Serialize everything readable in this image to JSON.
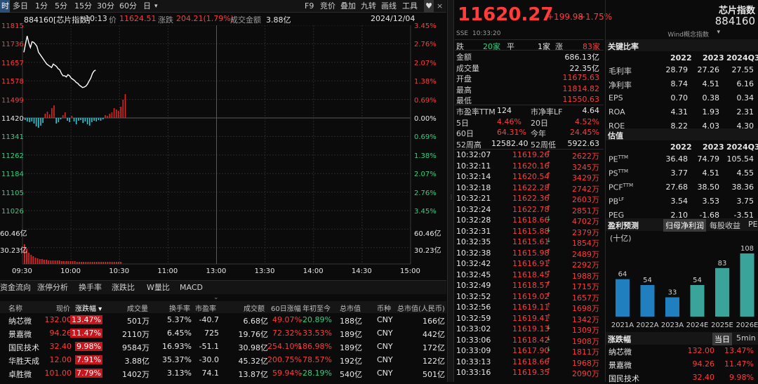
{
  "toolbar": {
    "left": [
      "时",
      "多日",
      "1分",
      "5分",
      "15分",
      "30分",
      "60分",
      "日",
      "▾"
    ],
    "right": [
      "F9",
      "竞价",
      "叠加",
      "九转",
      "画线",
      "工具"
    ],
    "heart": "♥"
  },
  "info": {
    "code": "884160[芯片指数]",
    "time": "10:13",
    "price_label": "价",
    "price": "11624.51",
    "chg_label": "涨跌",
    "chg": "204.21(1.79%)",
    "amt_label": "成交金额",
    "amt": "3.88亿",
    "date": "2024/12/04"
  },
  "chart_data": {
    "type": "line",
    "title": "",
    "x_ticks": [
      "09:30",
      "10:00",
      "10:30",
      "11:00",
      "13:00",
      "13:30",
      "14:00",
      "14:30",
      "15:00"
    ],
    "y_ticks": [
      "11815",
      "11736",
      "11657",
      "11578",
      "11499",
      "11420",
      "11341",
      "11262",
      "11184",
      "11105",
      "11026"
    ],
    "pct_ticks": [
      "3.45%",
      "2.76%",
      "2.07%",
      "1.38%",
      "0.69%",
      "0.00%",
      "0.69%",
      "1.38%",
      "2.07%",
      "2.76%",
      "3.45%"
    ],
    "vol_ticks": [
      "60.46亿",
      "30.23亿"
    ],
    "prev_close": 11420.3,
    "price_series": [
      11700,
      11735,
      11770,
      11740,
      11720,
      11745,
      11742,
      11735,
      11725,
      11700,
      11690,
      11680,
      11670,
      11660,
      11650,
      11645,
      11640,
      11635,
      11650,
      11645,
      11640,
      11630,
      11625,
      11610,
      11600,
      11600,
      11595,
      11605,
      11600,
      11590,
      11585,
      11580,
      11572,
      11568,
      11560,
      11555,
      11550,
      11552,
      11556,
      11565,
      11578,
      11590,
      11610,
      11620,
      11624
    ],
    "flow_bars": [
      -3,
      -5,
      -6,
      -5,
      -8,
      -12,
      -14,
      -11,
      -7,
      6,
      9,
      5,
      14,
      18,
      -8,
      -6,
      -2,
      4,
      8,
      -4,
      -6,
      3,
      -5,
      -9,
      -4,
      -3,
      -7,
      -5,
      -9,
      -11,
      -6,
      -4,
      -5,
      -3,
      -4,
      -2,
      4,
      3,
      6,
      8,
      14,
      12,
      10,
      16,
      26,
      34
    ],
    "volume_bars": [
      28,
      22,
      16,
      13,
      11,
      9,
      8,
      7,
      7,
      6,
      6,
      5,
      5,
      5,
      5,
      5,
      5,
      4,
      4,
      4,
      4,
      4,
      4,
      4,
      3,
      3,
      3,
      3,
      3,
      3,
      3,
      3,
      3,
      3,
      3,
      3,
      3,
      3,
      3,
      3,
      3,
      3,
      3,
      3,
      3
    ]
  },
  "bottom_tabs": [
    "资金流向",
    "涨停分析",
    "换手率",
    "涨跌比",
    "W量比",
    "MACD"
  ],
  "table": {
    "headers": [
      "名称",
      "现价",
      "涨跌幅 ▾",
      "成交量",
      "换手率",
      "市盈率",
      "成交额",
      "60日涨幅",
      "年初至今",
      "总市值",
      "币种",
      "总市值(人民币)"
    ],
    "rows": [
      [
        "纳芯微",
        "132.00",
        "13.47%",
        "501万",
        "5.37%",
        "-40.7",
        "6.68亿",
        "49.07%",
        "-20.89%",
        "188亿",
        "CNY",
        "166亿"
      ],
      [
        "景嘉微",
        "94.26",
        "11.47%",
        "2110万",
        "6.45%",
        "725",
        "19.76亿",
        "72.32%",
        "33.53%",
        "189亿",
        "CNY",
        "442亿"
      ],
      [
        "国民技术",
        "32.40",
        "9.98%",
        "9584万",
        "16.93%",
        "-51.1",
        "30.98亿",
        "254.10%",
        "186.98%",
        "189亿",
        "CNY",
        "172亿"
      ],
      [
        "华胜天成",
        "12.00",
        "7.91%",
        "3.88亿",
        "35.37%",
        "-30.0",
        "45.32亿",
        "200.75%",
        "78.57%",
        "192亿",
        "CNY",
        "122亿"
      ],
      [
        "卓胜微",
        "101.00",
        "7.79%",
        "1402万",
        "3.13%",
        "74.1",
        "13.87亿",
        "59.94%",
        "-28.19%",
        "540亿",
        "CNY",
        "501亿"
      ]
    ]
  },
  "quote": {
    "price": "11620.27",
    "chg": "+199.98",
    "pct": "+1.75%",
    "exchange": "SSE",
    "time": "10:33:20",
    "breadth": {
      "down_label": "跌",
      "down": "20家",
      "flat_label": "平",
      "flat": "1家",
      "up_label": "涨",
      "up": "83家"
    },
    "stats": [
      [
        "金额",
        "686.13亿"
      ],
      [
        "成交量",
        "22.35亿"
      ],
      [
        "开盘",
        "11675.63"
      ],
      [
        "最高",
        "11814.82"
      ],
      [
        "最低",
        "11550.63"
      ]
    ],
    "metrics": [
      [
        "市盈率TTM",
        "124",
        "市净率LF",
        "4.64"
      ],
      [
        "5日",
        "4.46%",
        "20日",
        "4.52%"
      ],
      [
        "60日",
        "64.31%",
        "今年",
        "24.45%"
      ],
      [
        "52周高",
        "12582.40",
        "52周低",
        "5922.63"
      ]
    ],
    "ticks": [
      [
        "10:32:07",
        "11619.26",
        "2622万"
      ],
      [
        "10:32:11",
        "11620.16",
        "3245万"
      ],
      [
        "10:32:14",
        "11620.54",
        "3429万"
      ],
      [
        "10:32:18",
        "11622.28",
        "2742万"
      ],
      [
        "10:32:21",
        "11622.36",
        "2603万"
      ],
      [
        "10:32:24",
        "11622.78",
        "2851万"
      ],
      [
        "10:32:28",
        "11618.66",
        "4702万"
      ],
      [
        "10:32:31",
        "11615.88",
        "2379万"
      ],
      [
        "10:32:35",
        "11615.61",
        "1854万"
      ],
      [
        "10:32:38",
        "11615.98",
        "2489万"
      ],
      [
        "10:32:42",
        "11616.91",
        "2292万"
      ],
      [
        "10:32:45",
        "11618.45",
        "1988万"
      ],
      [
        "10:32:49",
        "11618.57",
        "1715万"
      ],
      [
        "10:32:52",
        "11619.02",
        "1657万"
      ],
      [
        "10:32:56",
        "11619.11",
        "1698万"
      ],
      [
        "10:32:59",
        "11619.41",
        "1342万"
      ],
      [
        "10:33:02",
        "11619.13",
        "1309万"
      ],
      [
        "10:33:06",
        "11618.42",
        "1908万"
      ],
      [
        "10:33:09",
        "11617.90",
        "1811万"
      ],
      [
        "10:33:13",
        "11618.66",
        "1968万"
      ],
      [
        "10:33:16",
        "11619.35",
        "2090万"
      ]
    ],
    "tick_dirs": [
      "up",
      "up",
      "up",
      "up",
      "up",
      "up",
      "down",
      "down",
      "down",
      "up",
      "up",
      "up",
      "up",
      "up",
      "up",
      "up",
      "down",
      "down",
      "down",
      "up",
      "up"
    ]
  },
  "fin": {
    "name": "芯片指数",
    "code": "884160",
    "tag": "Wind概念指数",
    "ratio_title": "关键比率",
    "years": [
      "2022",
      "2023",
      "2024Q3"
    ],
    "ratios": [
      [
        "毛利率",
        "28.79",
        "27.26",
        "27.55"
      ],
      [
        "净利率",
        "8.74",
        "4.51",
        "6.16"
      ],
      [
        "EPS",
        "0.70",
        "0.38",
        "0.34"
      ],
      [
        "ROA",
        "4.31",
        "1.93",
        "2.31"
      ],
      [
        "ROE",
        "8.22",
        "4.03",
        "4.30"
      ]
    ],
    "val_title": "估值",
    "vals": [
      [
        "PETTM",
        "36.48",
        "74.79",
        "105.54"
      ],
      [
        "PSTTM",
        "3.77",
        "4.51",
        "4.55"
      ],
      [
        "PCFTTM",
        "27.68",
        "38.50",
        "38.36"
      ],
      [
        "PBLF",
        "3.54",
        "3.53",
        "3.75"
      ],
      [
        "PEG",
        "2.10",
        "-1.68",
        "-3.51"
      ]
    ],
    "forecast_title": "盈利预测",
    "forecast_tabs": [
      "归母净利润",
      "每股收益",
      "PE"
    ],
    "unit": "(十亿)",
    "forecast_chart": {
      "type": "bar",
      "categories": [
        "2021A",
        "2022A",
        "2023A",
        "2024E",
        "2025E",
        "2026E"
      ],
      "values": [
        64,
        54,
        33,
        54,
        83,
        108
      ],
      "value_labels": [
        "64",
        "54",
        "33",
        "54",
        "83",
        "108"
      ]
    },
    "movers_title": "涨跌幅",
    "movers_tabs": [
      "当日",
      "5min"
    ],
    "movers": [
      [
        "纳芯微",
        "132.00",
        "13.47%"
      ],
      [
        "景嘉微",
        "94.26",
        "11.47%"
      ],
      [
        "国民技术",
        "32.40",
        "9.98%"
      ]
    ],
    "colors": {
      "actual_bar": "#1f7fbf",
      "estimate_bar": "#3aa39a"
    }
  }
}
